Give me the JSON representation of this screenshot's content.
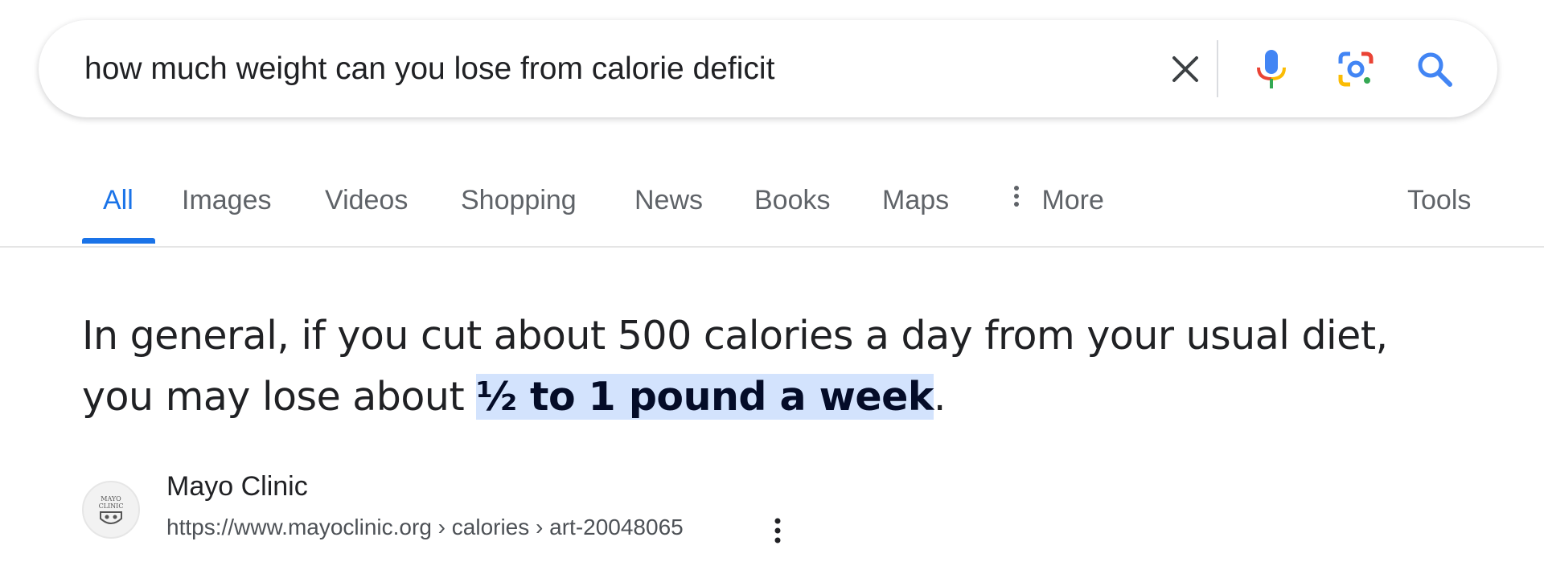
{
  "search": {
    "query": "how much weight can you lose from calorie deficit",
    "icons": [
      "close-icon",
      "microphone-icon",
      "google-lens-icon",
      "search-icon"
    ]
  },
  "tabs": [
    {
      "label": "All",
      "active": true
    },
    {
      "label": "Images"
    },
    {
      "label": "Videos"
    },
    {
      "label": "Shopping"
    },
    {
      "label": "News"
    },
    {
      "label": "Books"
    },
    {
      "label": "Maps"
    },
    {
      "label": "More",
      "icon": "vertical-dots-icon"
    },
    {
      "label": "Tools"
    }
  ],
  "featured_snippet": {
    "text_before": "In general, if you cut about 500 calories a day from your usual diet, you may lose about ",
    "highlight": "½ to 1 pound a week",
    "text_after": "."
  },
  "source": {
    "name": "Mayo Clinic",
    "url": "https://www.mayoclinic.org › calories › art-20048065",
    "favicon_text": "MAYO CLINIC"
  },
  "colors": {
    "accent": "#1a73e8",
    "highlight_bg": "#d3e3fd",
    "mic_blue": "#4285f4",
    "mic_red": "#ea4335",
    "mic_yellow": "#fbbc04",
    "mic_green": "#34a853"
  }
}
